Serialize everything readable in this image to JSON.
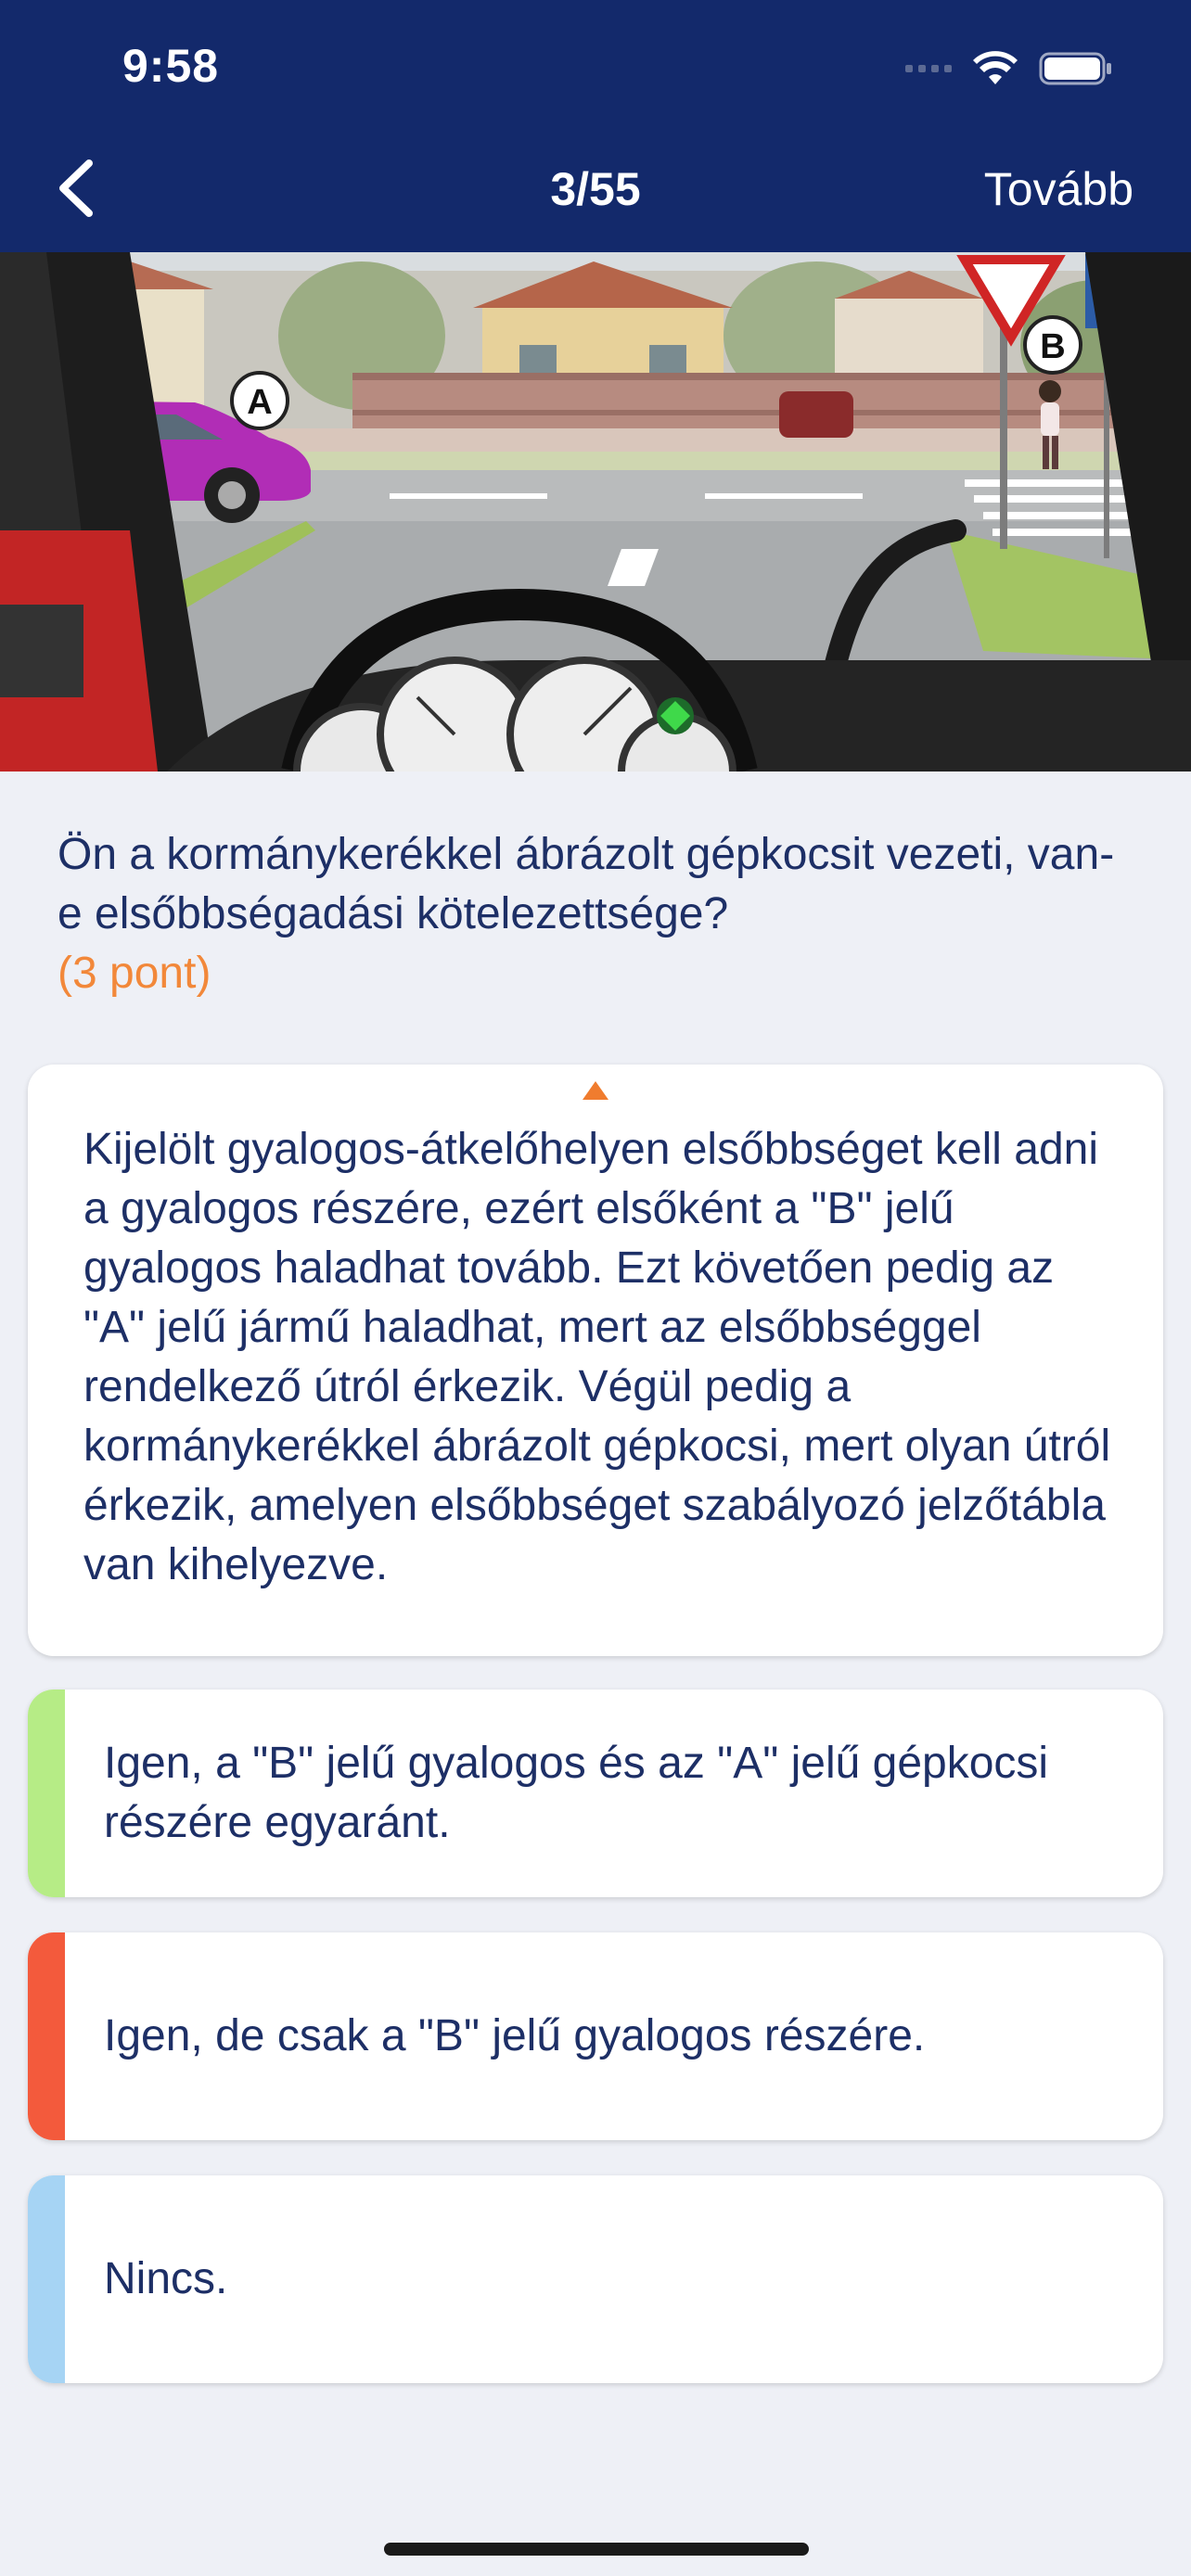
{
  "status": {
    "time": "9:58"
  },
  "nav": {
    "title": "3/55",
    "next_label": "Tovább"
  },
  "image": {
    "marker_a": "A",
    "marker_b": "B"
  },
  "question": {
    "text": "Ön a kormánykerékkel ábrázolt gépkocsit vezeti, van-e elsőbbségadási kötelezettsége?",
    "points": "(3 pont)"
  },
  "explanation": {
    "text": "Kijelölt gyalogos-átkelőhelyen elsőbbséget kell adni a gyalogos részére, ezért elsőként a \"B\" jelű gyalogos haladhat tovább. Ezt követően pedig az \"A\" jelű jármű haladhat, mert az elsőbbséggel rendelkező útról érkezik. Végül pedig a kormánykerékkel ábrázolt gépkocsi, mert olyan útról érkezik, amelyen elsőbbséget szabályozó jelzőtábla van kihelyezve."
  },
  "answers": [
    {
      "text": "Igen, a \"B\" jelű gyalogos és az \"A\" jelű gépkocsi részére egyaránt.",
      "color": "#b6ec86"
    },
    {
      "text": "Igen, de csak a \"B\" jelű gyalogos részére.",
      "color": "#f35a3c"
    },
    {
      "text": "Nincs.",
      "color": "#a6d4f4"
    }
  ]
}
